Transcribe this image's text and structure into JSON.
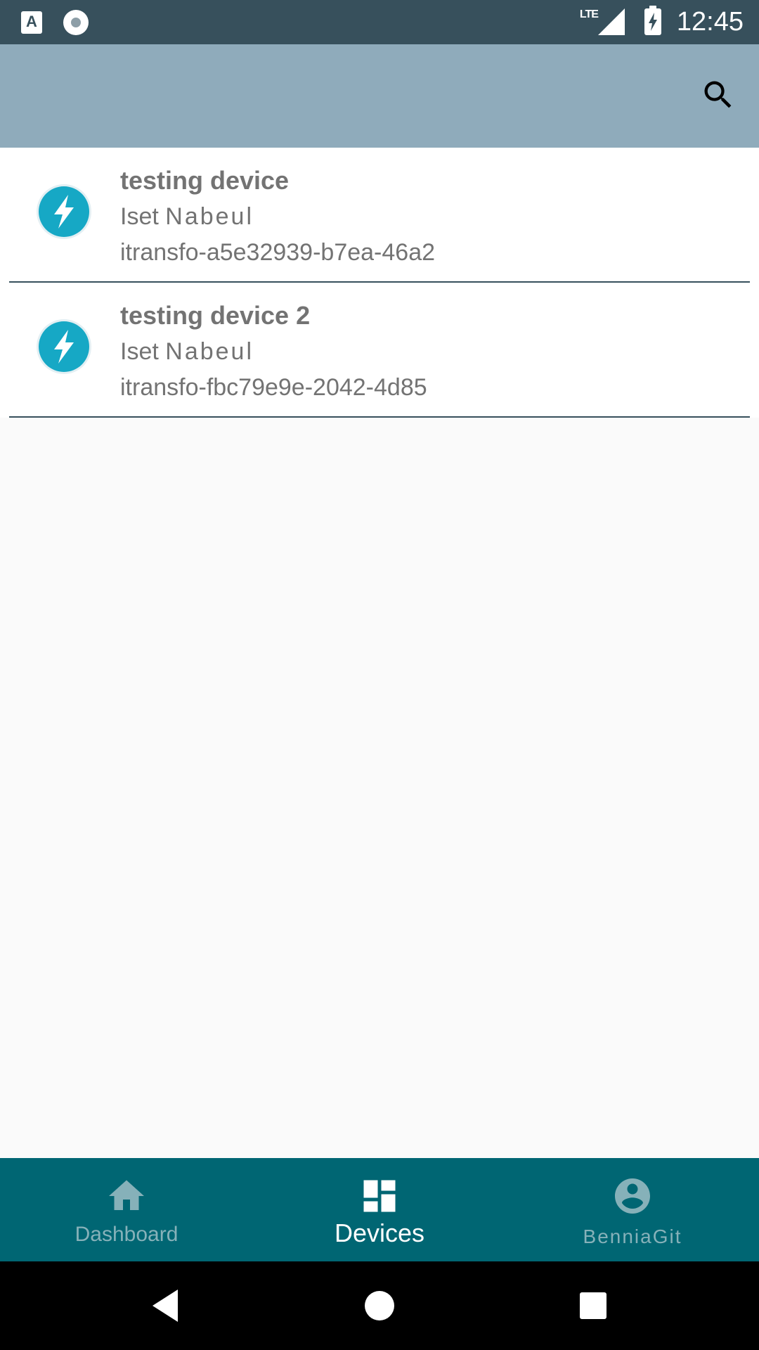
{
  "status_bar": {
    "notification_icons": [
      "accessibility-a-icon",
      "record-circle-icon"
    ],
    "network": "LTE",
    "time": "12:45",
    "colors": {
      "background": "#37505c"
    }
  },
  "app_bar": {
    "background": "#8fabbb",
    "search_icon": "search-icon"
  },
  "devices": [
    {
      "name": "testing device",
      "location_part1": "Iset",
      "location_part2": "Nabeul",
      "identifier": "itransfo-a5e32939-b7ea-46a2",
      "icon": "bolt-icon"
    },
    {
      "name": "testing device 2",
      "location_part1": "Iset",
      "location_part2": "Nabeul",
      "identifier": "itransfo-fbc79e9e-2042-4d85",
      "icon": "bolt-icon"
    }
  ],
  "bottom_nav": {
    "background": "#006673",
    "items": [
      {
        "label": "Dashboard",
        "icon": "home-icon",
        "active": false
      },
      {
        "label": "Devices",
        "icon": "dashboard-grid-icon",
        "active": true
      },
      {
        "label": "BenniaGit",
        "icon": "account-circle-icon",
        "active": false
      }
    ]
  },
  "system_nav": {
    "buttons": [
      "back-icon",
      "home-circle-icon",
      "recents-square-icon"
    ]
  }
}
